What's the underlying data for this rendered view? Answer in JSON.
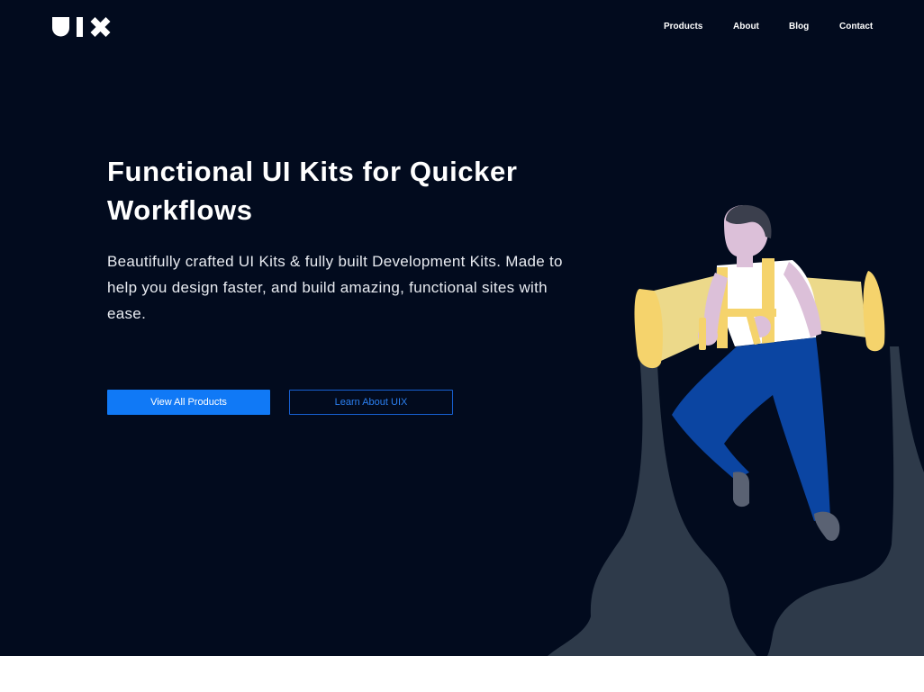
{
  "nav": {
    "items": [
      {
        "label": "Products"
      },
      {
        "label": "About"
      },
      {
        "label": "Blog"
      },
      {
        "label": "Contact"
      }
    ]
  },
  "hero": {
    "headline": "Functional UI Kits for Quicker Workflows",
    "subtitle": "Beautifully crafted UI Kits & fully built Development Kits. Made to help you design faster, and build amazing, functional sites with ease.",
    "primary_button": "View All Products",
    "secondary_button": "Learn About UIX"
  },
  "colors": {
    "background": "#020b1e",
    "accent": "#1079f6",
    "text": "#ffffff",
    "footer_band": "#ffffff"
  },
  "icons": {
    "logo": "uix-logo",
    "illustration": "jetpack-person-illustration"
  }
}
